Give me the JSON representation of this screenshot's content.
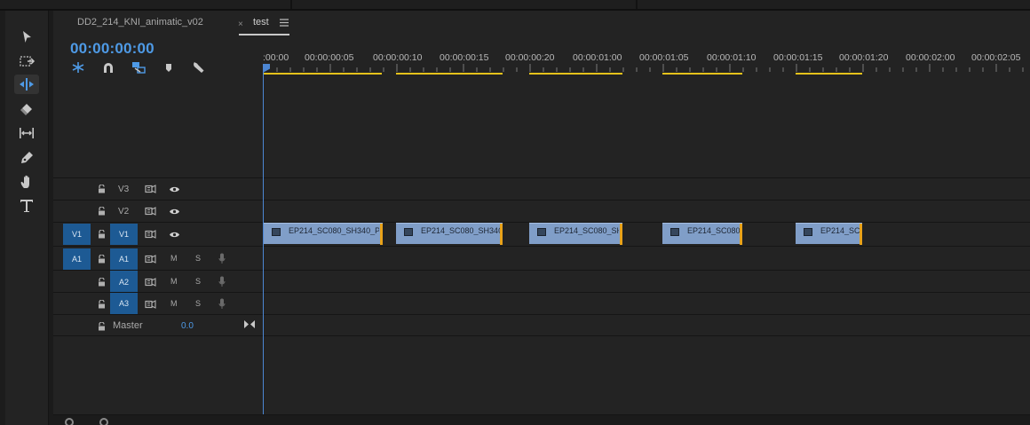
{
  "tabs": [
    {
      "label": "DD2_214_KNI_animatic_v02"
    },
    {
      "label": "test",
      "close": "×",
      "menu": "≡"
    }
  ],
  "timecode": "00:00:00:00",
  "tools": [
    {
      "icon": "selection-tool-icon"
    },
    {
      "icon": "track-select-forward-icon"
    },
    {
      "icon": "ripple-edit-icon",
      "active": true
    },
    {
      "icon": "razor-icon"
    },
    {
      "icon": "slip-icon"
    },
    {
      "icon": "pen-icon"
    },
    {
      "icon": "hand-icon"
    },
    {
      "icon": "type-icon"
    }
  ],
  "timeline_icons": [
    "nest-sequence-icon",
    "snap-icon",
    "linked-selection-icon",
    "add-marker-icon",
    "settings-wrench-icon"
  ],
  "ruler": {
    "labels": [
      ":00:00",
      "00:00:00:05",
      "00:00:00:10",
      "00:00:00:15",
      "00:00:00:20",
      "00:00:01:00",
      "00:00:01:05",
      "00:00:01:10",
      "00:00:01:15",
      "00:00:01:20",
      "00:00:02:00",
      "00:00:02:05"
    ],
    "work_area_color": "#e5c21b"
  },
  "tracks": {
    "video": [
      {
        "name": "V3"
      },
      {
        "name": "V2"
      },
      {
        "name": "V1",
        "source": "V1"
      }
    ],
    "audio": [
      {
        "name": "A1",
        "source": "A1",
        "mute": "M",
        "solo": "S"
      },
      {
        "name": "A2",
        "mute": "M",
        "solo": "S"
      },
      {
        "name": "A3",
        "mute": "M",
        "solo": "S"
      }
    ],
    "master": {
      "label": "Master",
      "value": "0.0"
    }
  },
  "clips": [
    {
      "name": "EP214_SC080_SH340_PN"
    },
    {
      "name": "EP214_SC080_SH340_"
    },
    {
      "name": "EP214_SC080_SH3"
    },
    {
      "name": "EP214_SC080_"
    },
    {
      "name": "EP214_SC0"
    }
  ],
  "colors": {
    "accent": "#4e9ae6",
    "clip": "#809ec8",
    "target": "#1d5a94"
  }
}
